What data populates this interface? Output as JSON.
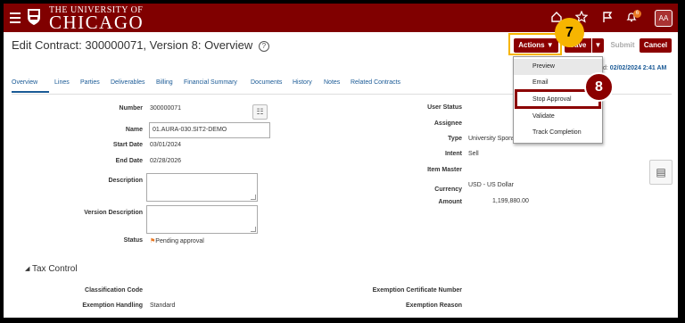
{
  "header": {
    "university_line1": "THE UNIVERSITY OF",
    "university_line2": "CHICAGO",
    "notification_count": "6",
    "avatar_initials": "AA"
  },
  "page": {
    "title": "Edit Contract: 300000071, Version 8: Overview",
    "help": "?"
  },
  "toolbar": {
    "actions_label": "Actions ▼",
    "save_label": "Save",
    "save_drop": "▼",
    "submit_label": "Submit",
    "cancel_label": "Cancel",
    "last_saved_prefix": "d:",
    "last_saved": "02/02/2024 2:41 AM"
  },
  "tabs": [
    "Overview",
    "Lines",
    "Parties",
    "Deliverables",
    "Billing",
    "Financial Summary",
    "Documents",
    "History",
    "Notes",
    "Related Contracts"
  ],
  "left_form": {
    "number_label": "Number",
    "number_value": "300000071",
    "name_label": "Name",
    "name_value": "01.AURA-030.SIT2-DEMO",
    "start_label": "Start Date",
    "start_value": "03/01/2024",
    "end_label": "End Date",
    "end_value": "02/28/2026",
    "description_label": "Description",
    "version_desc_label": "Version Description",
    "status_label": "Status",
    "status_value": "Pending approval"
  },
  "right_form": {
    "user_status_label": "User Status",
    "assignee_label": "Assignee",
    "type_label": "Type",
    "type_value": "University Sponsored Award",
    "intent_label": "Intent",
    "intent_value": "Sell",
    "item_master_label": "Item Master",
    "currency_label": "Currency",
    "currency_value": "USD - US Dollar",
    "amount_label": "Amount",
    "amount_value": "1,199,880.00"
  },
  "tax_control": {
    "heading": "Tax Control",
    "classification_label": "Classification Code",
    "exemption_handling_label": "Exemption Handling",
    "exemption_handling_value": "Standard",
    "exemption_cert_label": "Exemption Certificate Number",
    "exemption_reason_label": "Exemption Reason"
  },
  "actions_menu": {
    "items": [
      "Preview",
      "Email",
      "Stop Approval",
      "Validate",
      "Track Completion"
    ]
  },
  "callouts": {
    "step_a": "7",
    "step_b": "8"
  },
  "colors": {
    "brand": "#800000",
    "accent": "#8b0000",
    "highlight": "#f7b500",
    "link": "#1a5a96"
  }
}
